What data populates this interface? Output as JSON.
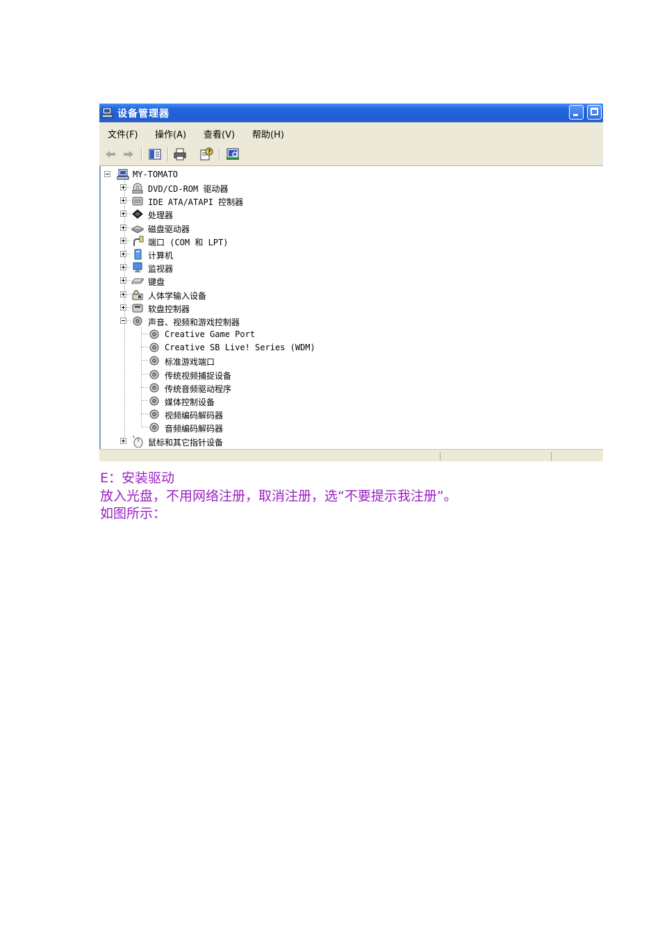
{
  "window": {
    "title": "设备管理器",
    "menu": [
      "文件(F)",
      "操作(A)",
      "查看(V)",
      "帮助(H)"
    ],
    "toolbar_icons": [
      "back-arrow-icon",
      "forward-arrow-icon",
      "show-hide-tree-icon",
      "print-icon",
      "properties-help-icon",
      "scan-hardware-icon"
    ]
  },
  "tree": {
    "root": "MY-TOMATO",
    "categories": [
      "DVD/CD-ROM 驱动器",
      "IDE ATA/ATAPI 控制器",
      "处理器",
      "磁盘驱动器",
      "端口 (COM 和 LPT)",
      "计算机",
      "监视器",
      "键盘",
      "人体学输入设备",
      "软盘控制器",
      "声音、视频和游戏控制器"
    ],
    "sound_children": [
      "Creative Game Port",
      "Creative SB Live! Series (WDM)",
      "标准游戏端口",
      "传统视频捕捉设备",
      "传统音频驱动程序",
      "媒体控制设备",
      "视频编码解码器",
      "音频编码解码器"
    ],
    "after": "鼠标和其它指针设备"
  },
  "doc": {
    "line1": "E：安装驱动",
    "line2": "放入光盘，不用网络注册，取消注册，选“不要提示我注册”。",
    "line3": "如图所示："
  },
  "colors": {
    "text_purple": "#9a1fc2",
    "titlebar_blue": "#2565d9"
  }
}
